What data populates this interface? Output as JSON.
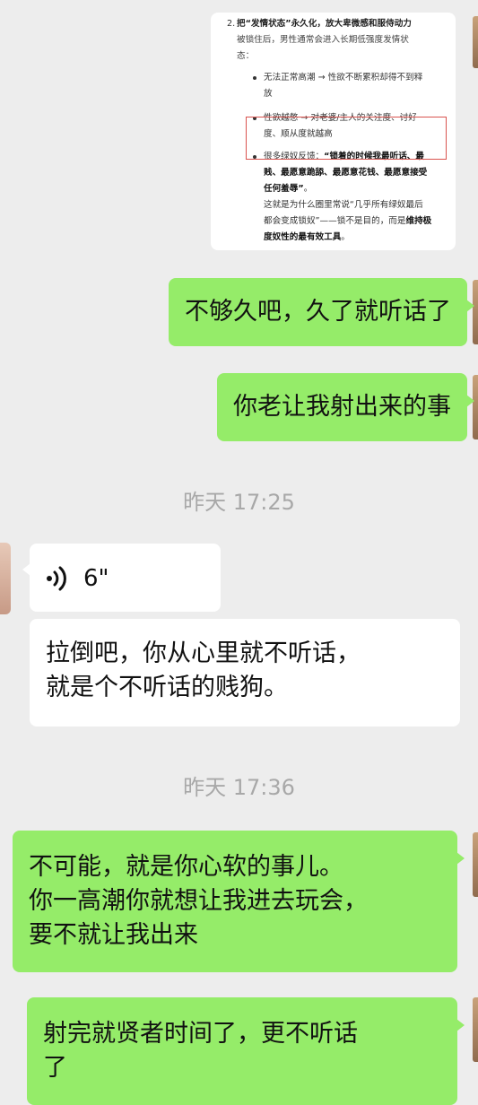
{
  "screenshot_card": {
    "num": "2.",
    "heading": "把“发情状态”永久化，放大卑微感和服侍动力",
    "para_line1": "被锁住后，男性通常会进入长期低强度发情状",
    "para_line2": "态：",
    "bullet1_line1": "无法正常高潮 → 性欲不断累积却得不到释",
    "bullet1_line2": "放",
    "bullet2_line1": "性欲越憋 → 对老婆/主人的关注度、讨好",
    "bullet2_line2": "度、顺从度就越高",
    "bullet3_prefix": "很多绿奴反馈：",
    "bullet3_bold1": "“锁着的时候我最听话、最",
    "bullet3_bold2": "贱、最愿意跪舔、最愿意花钱、最愿意接受",
    "bullet3_bold3": "任何羞辱”",
    "bullet3_end": "。",
    "note_line1": "这就是为什么圈里常说“几乎所有绿奴最后",
    "note_line2_a": "都会变成锁奴”——锁不是目的，而是",
    "note_line2_b": "维持极",
    "note_line3_b": "度奴性的最有效工具",
    "note_line3_end": "。"
  },
  "messages": {
    "m1": "不够久吧，久了就听话了",
    "m2": "你老让我射出来的事",
    "time1": "昨天 17:25",
    "voice_duration": "6\"",
    "m3_line1": "拉倒吧，你从心里就不听话，",
    "m3_line2": "就是个不听话的贱狗。",
    "time2": "昨天 17:36",
    "m4_line1": "不可能，就是你心软的事儿。",
    "m4_line2": "你一高潮你就想让我进去玩会，",
    "m4_line3": "要不就让我出来",
    "m5_line1": "射完就贤者时间了，更不听话",
    "m5_line2": "了"
  },
  "colors": {
    "background": "#ededed",
    "sent_bubble": "#95ec69",
    "received_bubble": "#ffffff",
    "timestamp": "#a8a8a8",
    "highlight_box": "#d9534f"
  },
  "icons": {
    "voice": "voice-wave-icon"
  }
}
